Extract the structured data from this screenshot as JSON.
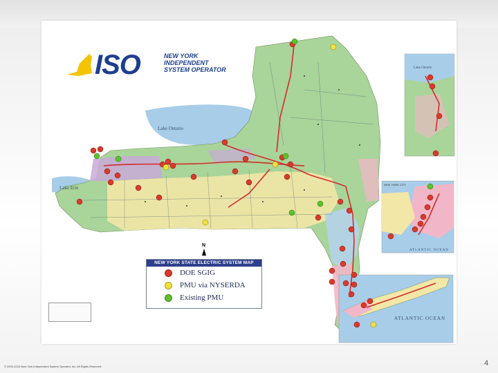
{
  "logo": {
    "brand": "ISO",
    "line1": "NEW YORK",
    "line2": "INDEPENDENT",
    "line3": "SYSTEM OPERATOR"
  },
  "map": {
    "labels": {
      "lake_ontario": "Lake Ontario",
      "lake_erie": "Lake Erie",
      "inset_lake_ontario": "Lake Ontario",
      "atlantic_ocean_inset": "ATLANTIC OCEAN",
      "atlantic_ocean_li": "ATLANTIC OCEAN",
      "nyc_inset_title": "NEW YORK CITY",
      "north": "N"
    },
    "colors": {
      "land_green": "#a9d49a",
      "land_yellow": "#f2e7a6",
      "land_purple": "#c9a9d8",
      "land_pink": "#f1b7c8",
      "land_blue": "#b5d3ea",
      "water": "#a8cde8",
      "transmission_red": "#d42b2b"
    }
  },
  "legend": {
    "title": "NEW YORK STATE ELECTRIC SYSTEM MAP",
    "items": [
      {
        "label": "DOE SGIG",
        "color": "#d93a2b"
      },
      {
        "label": "PMU via NYSERDA",
        "color": "#f2e13b"
      },
      {
        "label": "Existing PMU",
        "color": "#5cc22c"
      }
    ]
  },
  "footer": {
    "copyright": "© 2000-2010 New York Independent System Operator, Inc. All Rights Reserved.",
    "page_number": "4"
  }
}
